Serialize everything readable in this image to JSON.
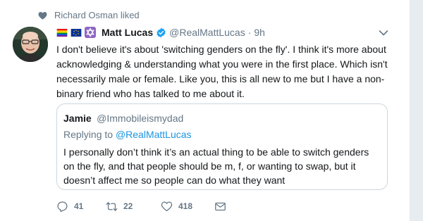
{
  "context": {
    "label": "Richard Osman liked"
  },
  "tweet": {
    "author_name": "Matt Lucas",
    "handle": "@RealMattLucas",
    "separator": "·",
    "time": "9h",
    "text": "I don't believe it's about 'switching genders on the fly'. I think it's more about acknowledging & understanding what you were in the first place. Which isn't necessarily male or female. Like you, this is all new to me but I have a non-binary friend who has talked to me about it."
  },
  "quote": {
    "author_name": "Jamie",
    "handle": "@Immobileismydad",
    "replying_prefix": "Replying to",
    "replying_to": "@RealMattLucas",
    "text": "I personally don’t think it’s an actual thing to be able to switch genders on the fly, and that people should be m, f, or wanting to swap, but it doesn’t affect me so people can do what they want"
  },
  "actions": {
    "replies": "41",
    "retweets": "22",
    "likes": "418"
  },
  "icons": {
    "context": "heart-icon",
    "verified": "verified-badge-icon",
    "caret": "chevron-down-icon",
    "reply": "reply-icon",
    "retweet": "retweet-icon",
    "like": "heart-outline-icon",
    "dm": "envelope-icon"
  },
  "colors": {
    "link": "#1b95e0",
    "secondary_text": "#657786",
    "border": "#ccd6dd"
  }
}
